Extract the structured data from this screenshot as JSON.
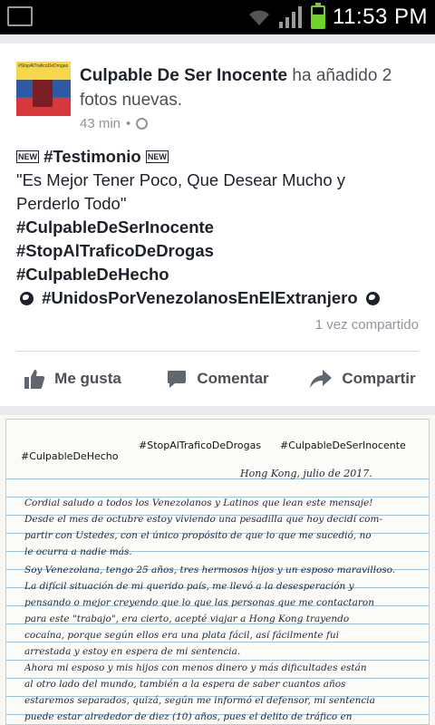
{
  "status_bar": {
    "time": "11:53 PM",
    "icons": [
      "image-notification-icon",
      "wifi-icon",
      "signal-icon",
      "battery-icon"
    ]
  },
  "post": {
    "author": "Culpable De Ser Inocente",
    "action_text": " ha añadido 2 fotos nuevas.",
    "time_ago": "43 min",
    "separator": "•",
    "privacy_icon": "globe-icon",
    "avatar_caption": "#StopAlTraficoDeDrogas",
    "new_badge": "NEW",
    "line1_tag": "#Testimonio",
    "quote_line1": "\"Es Mejor Tener Poco, Que Desear Mucho y",
    "quote_line2": "Perderlo Todo\"",
    "hashtag1": "#CulpableDeSerInocente",
    "hashtag2": "#StopAlTraficoDeDrogas",
    "hashtag3": "#CulpableDeHecho",
    "hashtag4": "#UnidosPorVenezolanosEnElExtranjero",
    "share_count": "1 vez compartido"
  },
  "actions": {
    "like": "Me gusta",
    "comment": "Comentar",
    "share": "Compartir"
  },
  "photo": {
    "tag_left": "#CulpableDeHecho",
    "tag_center": "#StopAlTraficoDeDrogas",
    "tag_right": "#CulpableDeSerInocente",
    "date_line": "Hong Kong, julio de 2017.",
    "lines": [
      "Cordial saludo a todos los Venezolanos y Latinos que lean este mensaje!",
      "Desde el mes de octubre estoy viviendo una pesadilla que hoy decidí com-",
      "partir con Ustedes, con el único propósito de que lo que me sucedió, no",
      "le ocurra a nadie más.",
      "Soy Venezolana, tengo 25 años, tres hermosos hijos y un esposo maravilloso.",
      "La difícil situación de mi querido país, me llevó a la desesperación y",
      "pensando o mejor creyendo que lo que las personas que me contactaron",
      "para este \"trabajo\", era cierto, acepté viajar a Hong Kong trayendo",
      "cocaína, porque según ellos era una plata fácil, así fácilmente fui",
      "arrestada y estoy en espera de mi sentencia.",
      "Ahora mi esposo y mis hijos con menos dinero y más dificultades están",
      "al otro lado del mundo, también a la espera de saber cuantos años",
      "estaremos separados, quizá, según me informó el defensor, mi sentencia",
      "puede estar alrededor de diez (10) años, pues el delito de tráfico en"
    ]
  }
}
